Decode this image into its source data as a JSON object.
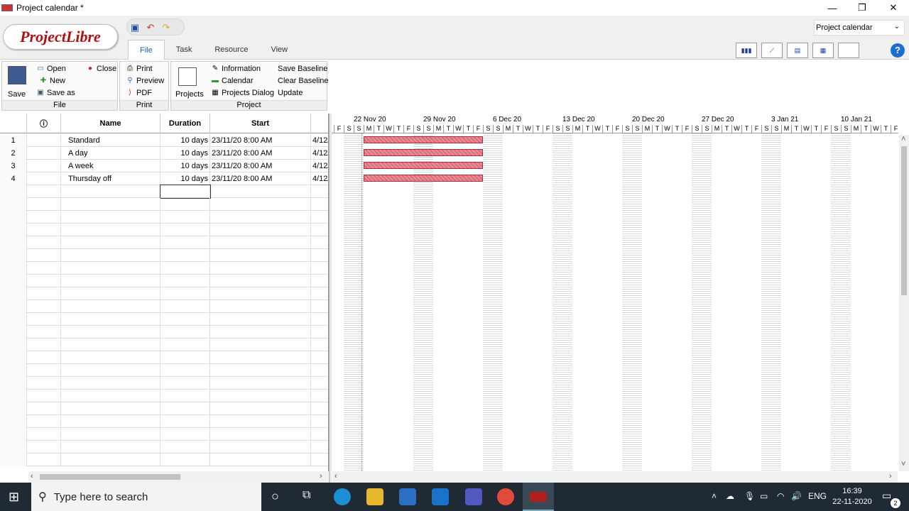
{
  "window": {
    "title": "Project calendar *",
    "minimize": "—",
    "maximize": "❐",
    "close": "✕"
  },
  "app": {
    "logo_text": "ProjectLibre"
  },
  "tabs": [
    "File",
    "Task",
    "Resource",
    "View"
  ],
  "view_selector": {
    "value": "Project calendar"
  },
  "ribbon": {
    "file_group": {
      "label": "File",
      "save": "Save",
      "open": "Open",
      "close": "Close",
      "new": "New",
      "save_as": "Save as"
    },
    "print_group": {
      "label": "Print",
      "print": "Print",
      "preview": "Preview",
      "pdf": "PDF"
    },
    "project_group": {
      "label": "Project",
      "projects": "Projects",
      "information": "Information",
      "calendar": "Calendar",
      "projects_dialog": "Projects Dialog",
      "save_baseline": "Save Baseline",
      "clear_baseline": "Clear Baseline",
      "update": "Update"
    }
  },
  "table": {
    "headers": {
      "indicator": "ⓘ",
      "name": "Name",
      "duration": "Duration",
      "start": "Start"
    },
    "rows": [
      {
        "num": "1",
        "name": "Standard",
        "duration": "10 days",
        "start": "23/11/20 8:00 AM",
        "finish": "4/12/"
      },
      {
        "num": "2",
        "name": "A day",
        "duration": "10 days",
        "start": "23/11/20 8:00 AM",
        "finish": "4/12/"
      },
      {
        "num": "3",
        "name": "A week",
        "duration": "10 days",
        "start": "23/11/20 8:00 AM",
        "finish": "4/12/"
      },
      {
        "num": "4",
        "name": "Thursday off",
        "duration": "10 days",
        "start": "23/11/20 8:00 AM",
        "finish": "4/12/"
      }
    ]
  },
  "gantt": {
    "weeks": [
      "22 Nov 20",
      "29 Nov 20",
      "6 Dec 20",
      "13 Dec 20",
      "20 Dec 20",
      "27 Dec 20",
      "3 Jan 21",
      "10 Jan 21"
    ],
    "day_letters": [
      "S",
      "M",
      "T",
      "W",
      "T",
      "F",
      "S"
    ]
  },
  "taskbar": {
    "search_placeholder": "Type here to search",
    "language": "ENG",
    "time": "16:39",
    "date": "22-11-2020",
    "notifications": "2"
  }
}
